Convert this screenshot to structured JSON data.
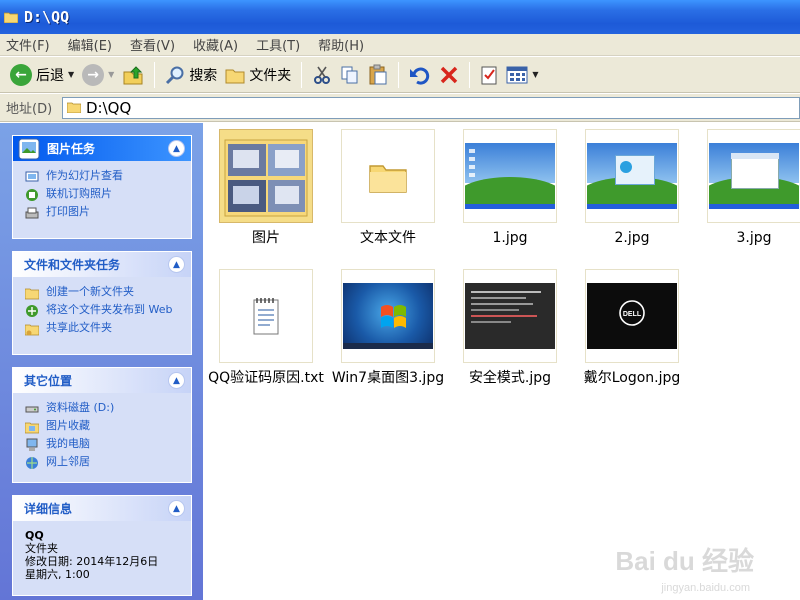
{
  "window": {
    "title": "D:\\QQ"
  },
  "menu": [
    "文件(F)",
    "编辑(E)",
    "查看(V)",
    "收藏(A)",
    "工具(T)",
    "帮助(H)"
  ],
  "toolbar": {
    "back_label": "后退",
    "search_label": "搜索",
    "folders_label": "文件夹"
  },
  "address": {
    "label": "地址(D)",
    "value": "D:\\QQ"
  },
  "sidebar": {
    "picture_tasks": {
      "title": "图片任务",
      "items": [
        "作为幻灯片查看",
        "联机订购照片",
        "打印图片"
      ]
    },
    "file_tasks": {
      "title": "文件和文件夹任务",
      "items": [
        "创建一个新文件夹",
        "将这个文件夹发布到 Web",
        "共享此文件夹"
      ]
    },
    "other_places": {
      "title": "其它位置",
      "items": [
        "资料磁盘 (D:)",
        "图片收藏",
        "我的电脑",
        "网上邻居"
      ]
    },
    "details": {
      "title": "详细信息",
      "name": "QQ",
      "type": "文件夹",
      "modified": "修改日期: 2014年12月6日",
      "modified2": "星期六, 1:00"
    }
  },
  "files": [
    {
      "name": "图片",
      "kind": "folder"
    },
    {
      "name": "文本文件",
      "kind": "folder"
    },
    {
      "name": "1.jpg",
      "kind": "image"
    },
    {
      "name": "2.jpg",
      "kind": "image"
    },
    {
      "name": "3.jpg",
      "kind": "image"
    },
    {
      "name": "QQ验证码原因.txt",
      "kind": "text"
    },
    {
      "name": "Win7桌面图3.jpg",
      "kind": "image"
    },
    {
      "name": "安全模式.jpg",
      "kind": "image"
    },
    {
      "name": "戴尔Logon.jpg",
      "kind": "image"
    }
  ],
  "watermark": {
    "brand": "Bai du 经验",
    "url": "jingyan.baidu.com"
  }
}
